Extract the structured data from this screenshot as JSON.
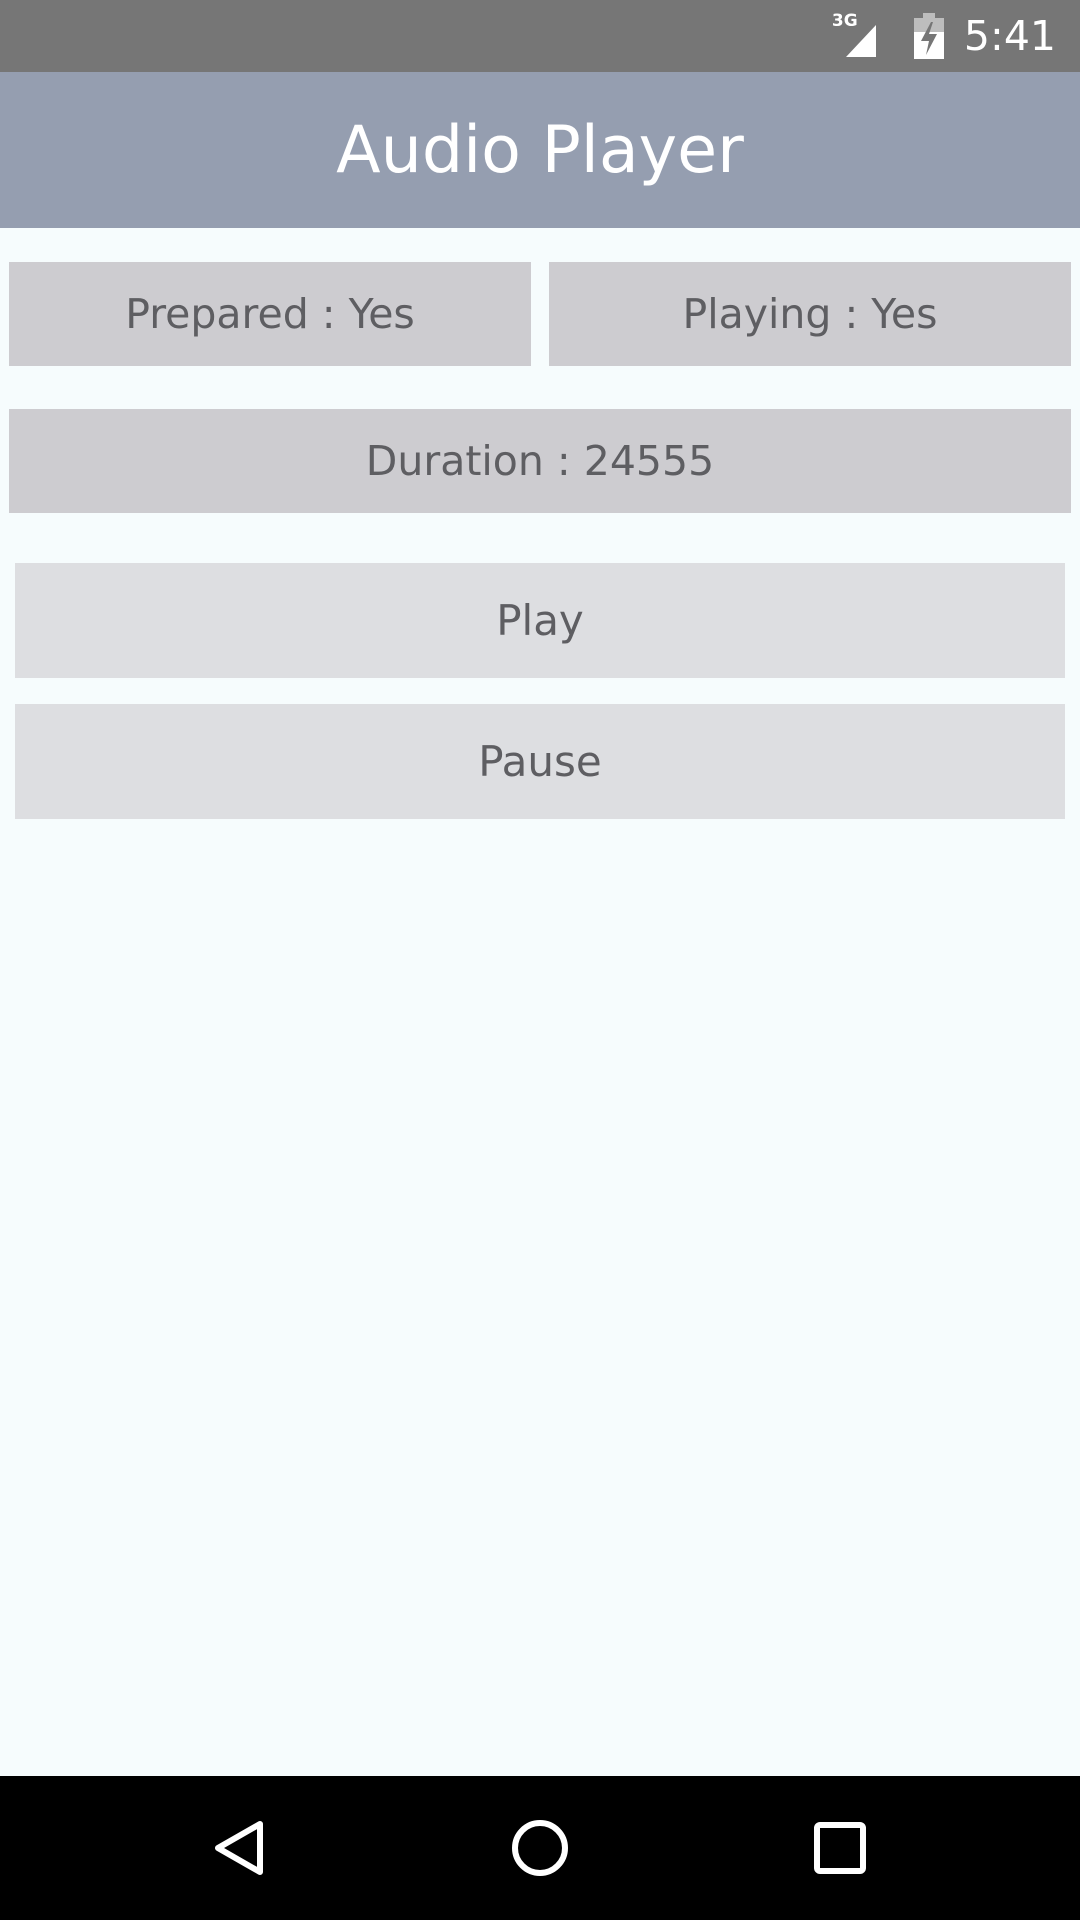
{
  "status_bar": {
    "network_type": "3G",
    "time": "5:41",
    "icons": [
      "signal-icon",
      "battery-charging-icon"
    ]
  },
  "app_bar": {
    "title": "Audio Player"
  },
  "status_boxes": {
    "prepared": "Prepared : Yes",
    "playing": "Playing : Yes",
    "duration": "Duration : 24555"
  },
  "controls": {
    "play_label": "Play",
    "pause_label": "Pause"
  },
  "nav_bar": {
    "icons": [
      "back-icon",
      "home-icon",
      "recents-icon"
    ]
  },
  "colors": {
    "status_bar": "#767676",
    "app_bar": "#959eb0",
    "background": "#f6fcfd",
    "status_box": "#cdccd0",
    "button": "#dddee1",
    "text": "#5e5e62"
  }
}
